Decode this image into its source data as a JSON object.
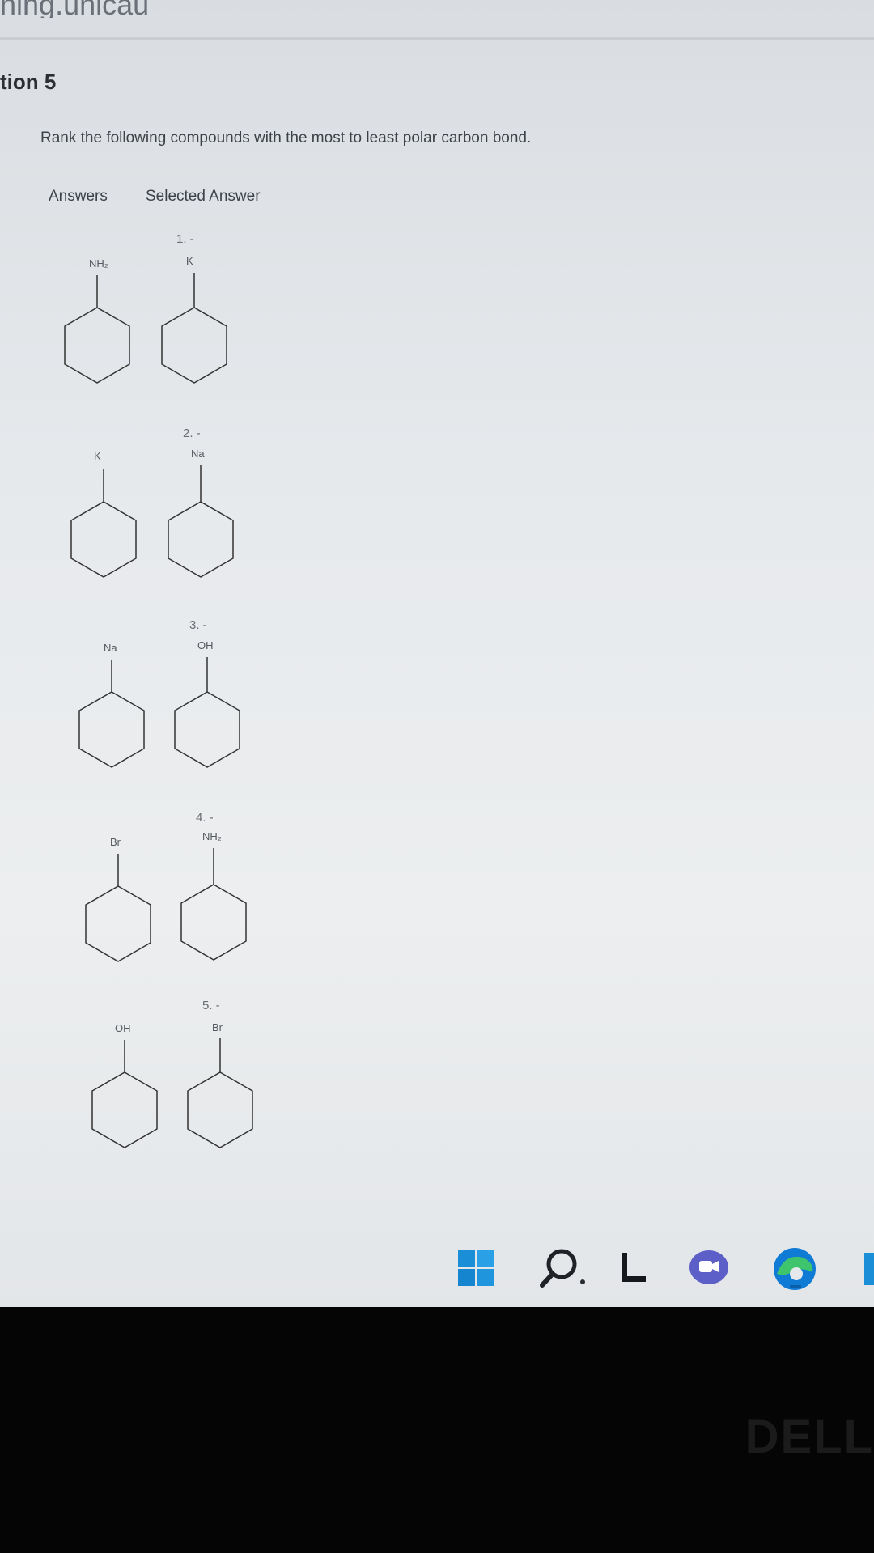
{
  "browser": {
    "url_fragment": "ning.unicau"
  },
  "question": {
    "title": "tion 5",
    "prompt": "Rank the following compounds with the most to least polar carbon bond.",
    "headers": {
      "answers": "Answers",
      "selected": "Selected Answer"
    }
  },
  "answers": [
    {
      "substituent": "NH₂"
    },
    {
      "substituent": "K"
    },
    {
      "substituent": "Na"
    },
    {
      "substituent": "Br"
    },
    {
      "substituent": "OH"
    }
  ],
  "selected": [
    {
      "rank": "1. -",
      "substituent": "K"
    },
    {
      "rank": "2. -",
      "substituent": "Na"
    },
    {
      "rank": "3. -",
      "substituent": "OH"
    },
    {
      "rank": "4. -",
      "substituent": "NH₂"
    },
    {
      "rank": "5. -",
      "substituent": "Br"
    }
  ],
  "taskbar": {
    "icons": [
      "windows-start-icon",
      "search-icon",
      "task-view-icon",
      "chat-icon",
      "edge-icon"
    ],
    "colors": {
      "start": "#1a8fd8",
      "chat": "#5b5fc7",
      "edge_blue": "#0f7bd4",
      "edge_green": "#3ec46d"
    }
  },
  "monitor": {
    "brand": "DELL"
  }
}
